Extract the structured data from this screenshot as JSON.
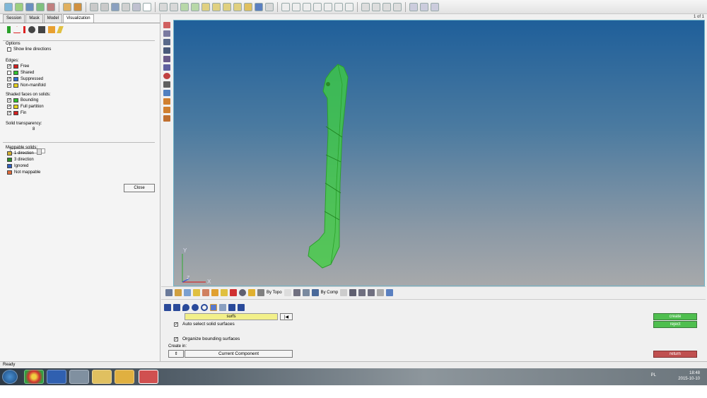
{
  "toolbar": {
    "icons": [
      "surface-icon",
      "mesh-icon",
      "save-icon",
      "edit-icon",
      "tools-icon",
      "user-icon",
      "import-icon",
      "arrow-left-icon",
      "arrow-right-icon",
      "model-icon",
      "box-icon",
      "view-icon",
      "ruler-icon",
      "node-icon",
      "zoom-icon",
      "rotate-icon",
      "pan-icon",
      "fit-icon",
      "window-icon"
    ]
  },
  "left_panel": {
    "tabs": [
      "Session",
      "Mask",
      "Model",
      "Visualization"
    ],
    "active_tab": "Visualization",
    "options_label": "Options",
    "show_line_directions": "Show line directions",
    "edges": {
      "title": "Edges:",
      "items": [
        {
          "label": "Free",
          "color": "#d22020",
          "checked": true
        },
        {
          "label": "Shared",
          "color": "#2fbf2f",
          "checked": false
        },
        {
          "label": "Suppressed",
          "color": "#2f6fd0",
          "checked": true
        },
        {
          "label": "Non-manifold",
          "color": "#e6d21e",
          "checked": true
        }
      ]
    },
    "shaded": {
      "title": "Shaded faces on solids:",
      "items": [
        {
          "label": "Bounding",
          "color": "#2fbf2f",
          "checked": true
        },
        {
          "label": "Full partition",
          "color": "#e6d21e",
          "checked": true
        },
        {
          "label": "Fin",
          "color": "#d22020",
          "checked": true
        }
      ]
    },
    "transparency": {
      "title": "Solid transparency:",
      "value": "8"
    },
    "mappable": {
      "title": "Mappable solids:",
      "items": [
        {
          "label": "1 direction",
          "color": "#d4b030"
        },
        {
          "label": "3 direction",
          "color": "#2a8a2a"
        },
        {
          "label": "Ignored",
          "color": "#2f5fc0"
        },
        {
          "label": "Not mappable",
          "color": "#e06a3a"
        }
      ]
    },
    "close_label": "Close"
  },
  "viewport": {
    "page_indicator": "1 of 1",
    "axis_y": "Y",
    "axis_x": "X",
    "axis_z": "Z",
    "model_color": "#3fd23f"
  },
  "view_toolbar": {
    "by_topo": "By Topo",
    "by_comp": "By Comp"
  },
  "panel": {
    "surfs_label": "surfs",
    "reset_label": "|◀",
    "auto_select": "Auto select solid surfaces",
    "organize": "Organize bounding surfaces",
    "create_in_label": "Create in:",
    "create_in_toggle": "⇕",
    "create_in_value": "Current Component",
    "create_btn": "create",
    "reject_btn": "reject",
    "return_btn": "return"
  },
  "status": {
    "text": "Ready"
  },
  "taskbar": {
    "lang": "PL",
    "time": "18:48",
    "date": "2015-10-10"
  }
}
